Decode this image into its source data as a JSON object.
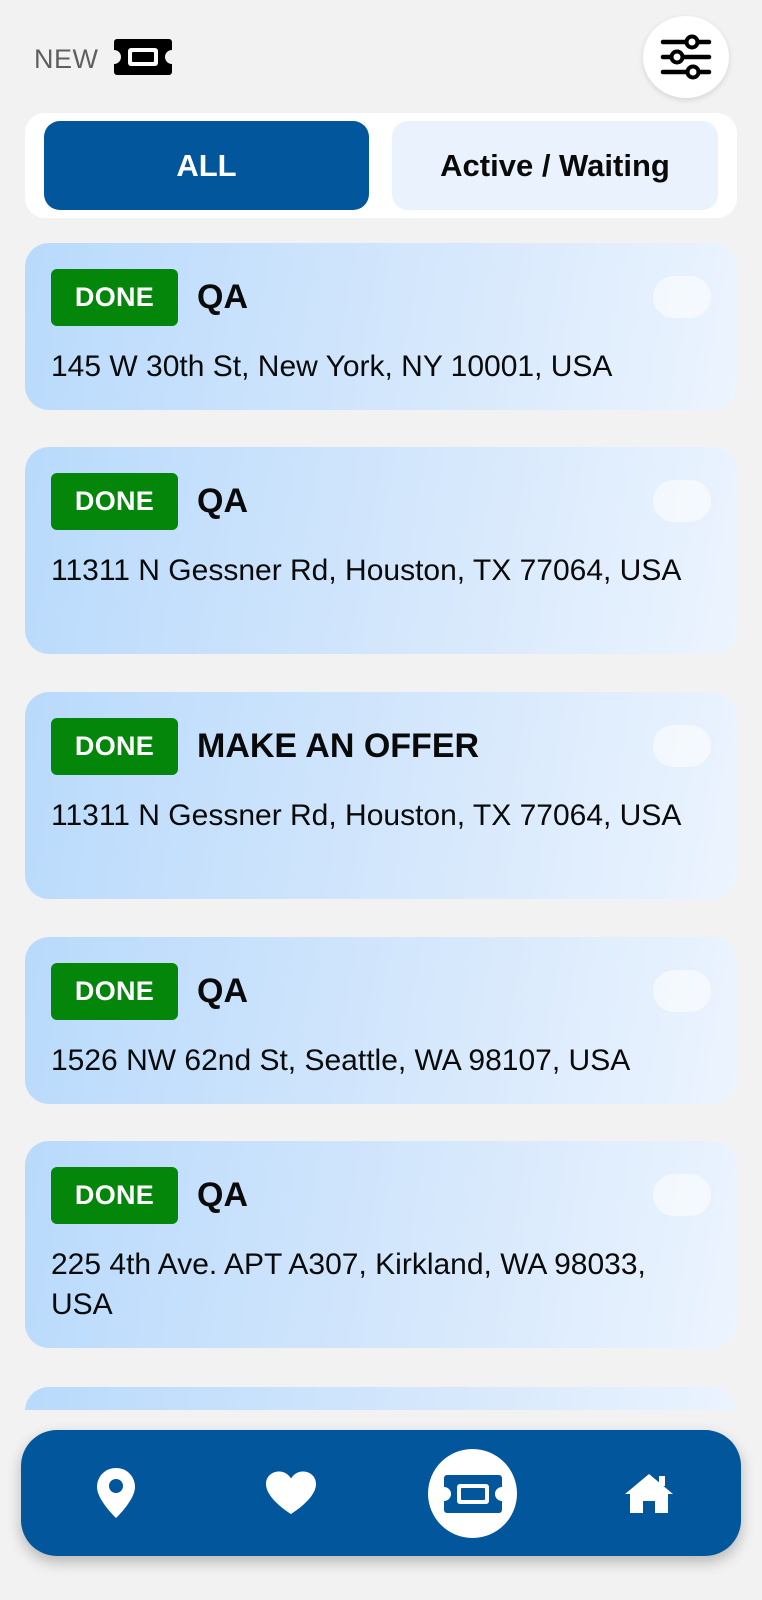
{
  "header": {
    "new_label": "NEW",
    "ticket_icon": "ticket-icon",
    "filter_icon": "sliders-icon"
  },
  "tabs": [
    {
      "label": "ALL",
      "selected": true
    },
    {
      "label": "Active / Waiting",
      "selected": false
    }
  ],
  "cards": [
    {
      "status": "DONE",
      "title": "QA",
      "address": "145 W 30th St, New York, NY 10001, USA"
    },
    {
      "status": "DONE",
      "title": "QA",
      "address": "11311 N Gessner Rd, Houston, TX 77064, USA"
    },
    {
      "status": "DONE",
      "title": "MAKE AN OFFER",
      "address": "11311 N Gessner Rd, Houston, TX 77064, USA"
    },
    {
      "status": "DONE",
      "title": "QA",
      "address": "1526 NW 62nd St, Seattle, WA 98107, USA"
    },
    {
      "status": "DONE",
      "title": "QA",
      "address": "225 4th Ave. APT A307, Kirkland, WA 98033, USA"
    }
  ],
  "colors": {
    "primary": "#02569b",
    "done_badge": "#04860b",
    "background": "#f2f2f2",
    "card_gradient_start": "#b9dafc",
    "card_gradient_end": "#ecf4fe"
  },
  "bottom_nav": [
    {
      "icon": "map-pin-icon",
      "selected": false
    },
    {
      "icon": "heart-icon",
      "selected": false
    },
    {
      "icon": "ticket-icon",
      "selected": true
    },
    {
      "icon": "home-icon",
      "selected": false
    }
  ]
}
